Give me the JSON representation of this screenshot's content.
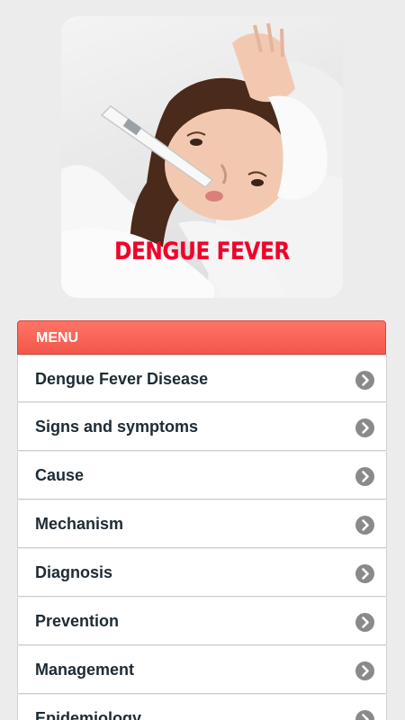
{
  "hero": {
    "caption": "DENGUE FEVER",
    "image_icon": "child-with-thermometer-image"
  },
  "menu": {
    "title": "MENU",
    "items": [
      {
        "label": "Dengue Fever Disease",
        "icon": "chevron-right-circle-icon"
      },
      {
        "label": "Signs and symptoms",
        "icon": "chevron-right-circle-icon"
      },
      {
        "label": "Cause",
        "icon": "chevron-right-circle-icon"
      },
      {
        "label": "Mechanism",
        "icon": "chevron-right-circle-icon"
      },
      {
        "label": "Diagnosis",
        "icon": "chevron-right-circle-icon"
      },
      {
        "label": "Prevention",
        "icon": "chevron-right-circle-icon"
      },
      {
        "label": "Management",
        "icon": "chevron-right-circle-icon"
      },
      {
        "label": "Epidemiology",
        "icon": "chevron-right-circle-icon"
      }
    ]
  },
  "colors": {
    "page_background": "#ececec",
    "menu_header": "#f2574a",
    "caption_red": "#f2002a",
    "item_text": "#1e2b34",
    "chevron_circle": "#8a8a8a"
  }
}
